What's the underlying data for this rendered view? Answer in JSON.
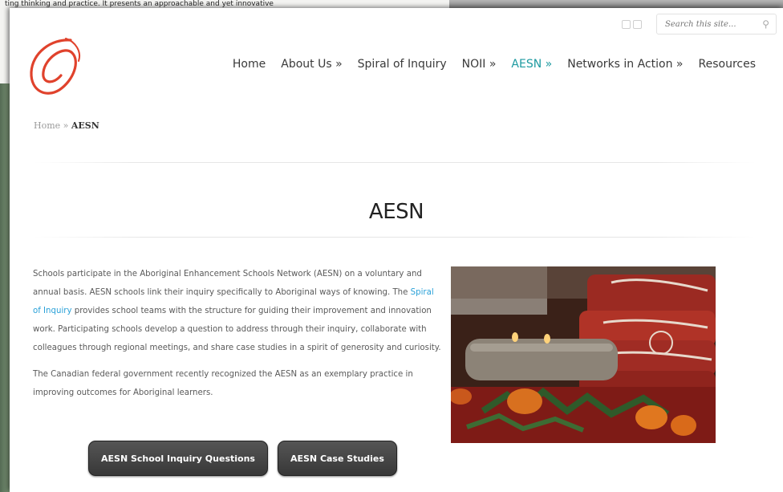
{
  "background_doc": {
    "line1": "ting thinking and practice. It presents an approachable and yet innovative"
  },
  "search": {
    "placeholder": "Search this site..."
  },
  "nav": {
    "items": [
      {
        "label": "Home"
      },
      {
        "label": "About Us »"
      },
      {
        "label": "Spiral of Inquiry"
      },
      {
        "label": "NOII »"
      },
      {
        "label": "AESN »"
      },
      {
        "label": "Networks in Action »"
      },
      {
        "label": "Resources"
      }
    ],
    "active_index": 4
  },
  "breadcrumb": {
    "home": "Home",
    "separator": " » ",
    "current": "AESN"
  },
  "page": {
    "title": "AESN",
    "para1_before": "Schools participate in the Aboriginal Enhancement Schools Network (AESN) on a voluntary and annual basis. AESN schools link their inquiry specifically to Aboriginal ways of knowing. The ",
    "para1_link": "Spiral of Inquiry",
    "para1_after": " provides school teams with the structure for guiding their improvement and innovation work. Participating schools develop a question to address through their inquiry, collaborate with colleagues through regional meetings, and share case studies in a spirit of generosity and curiosity.",
    "para2": "The Canadian federal government recently recognized the AESN as an exemplary practice in improving outcomes for Aboriginal learners."
  },
  "buttons": {
    "inquiry_questions": "AESN School Inquiry Questions",
    "case_studies": "AESN Case Studies"
  },
  "colors": {
    "accent": "#1d9aa0",
    "link": "#2aa1d8",
    "logo_red": "#e0422c",
    "button_dark": "#3f3f3f"
  }
}
